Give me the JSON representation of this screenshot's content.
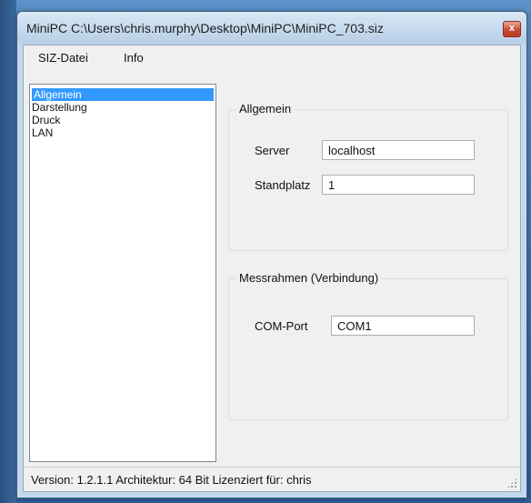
{
  "window": {
    "title": "MiniPC C:\\Users\\chris.murphy\\Desktop\\MiniPC\\MiniPC_703.siz",
    "close_glyph": "x"
  },
  "menu": {
    "items": [
      "SIZ-Datei",
      "Info"
    ]
  },
  "tree": {
    "items": [
      "Allgemein",
      "Darstellung",
      "Druck",
      "LAN"
    ],
    "selected": "Allgemein"
  },
  "group_general": {
    "title": "Allgemein",
    "server_label": "Server",
    "server_value": "localhost",
    "standplatz_label": "Standplatz",
    "standplatz_value": "1"
  },
  "group_frame": {
    "title": "Messrahmen (Verbindung)",
    "comport_label": "COM-Port",
    "comport_value": "COM1"
  },
  "status": {
    "text": "Version: 1.2.1.1 Architektur: 64 Bit Lizenziert für: chris"
  },
  "colors": {
    "selection": "#3399ff",
    "close_button": "#c94a33",
    "desktop": "#3f78b3"
  }
}
